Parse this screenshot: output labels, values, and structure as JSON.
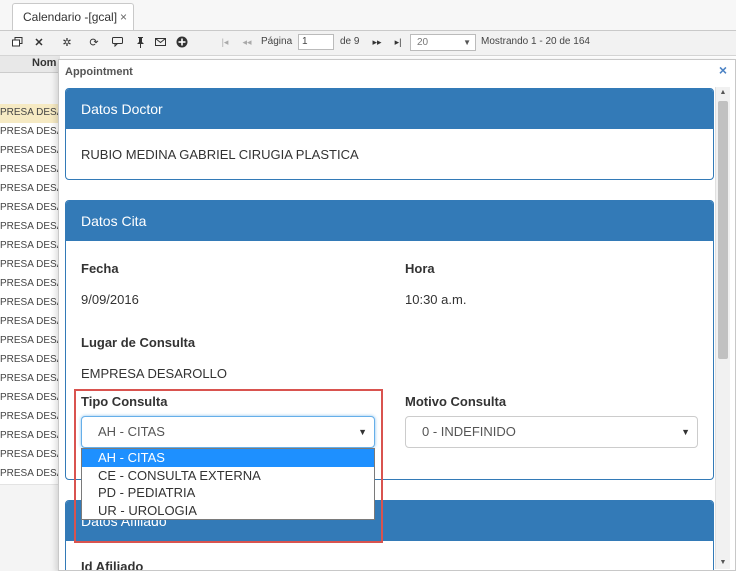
{
  "tab": {
    "title": "Calendario -[gcal]",
    "close": "×"
  },
  "toolbar": {
    "page_label": "Página",
    "page_value": "1",
    "of_label": "de 9",
    "page_size": "20",
    "range_text": "Mostrando 1 - 20 de 164"
  },
  "grid": {
    "column": "Nom",
    "rows": [
      "PRESA DESA",
      "PRESA DESA",
      "PRESA DESA",
      "PRESA DESA",
      "PRESA DESA",
      "PRESA DESA",
      "PRESA DESA",
      "PRESA DESA",
      "PRESA DESA",
      "PRESA DESA",
      "PRESA DESA",
      "PRESA DESA",
      "PRESA DESA",
      "PRESA DESA",
      "PRESA DESA",
      "PRESA DESA",
      "PRESA DESA",
      "PRESA DESA",
      "PRESA DESA",
      "PRESA DESA"
    ]
  },
  "dialog": {
    "title": "Appointment",
    "close": "×",
    "doctor": {
      "heading": "Datos Doctor",
      "name": "RUBIO MEDINA GABRIEL CIRUGIA PLASTICA"
    },
    "cita": {
      "heading": "Datos Cita",
      "fecha_label": "Fecha",
      "fecha_value": "9/09/2016",
      "hora_label": "Hora",
      "hora_value": "10:30 a.m.",
      "lugar_label": "Lugar de Consulta",
      "lugar_value": "EMPRESA DESAROLLO",
      "tipo_label": "Tipo Consulta",
      "tipo_selected": "AH - CITAS",
      "tipo_options": [
        "AH - CITAS",
        "CE - CONSULTA EXTERNA",
        "PD - PEDIATRIA",
        "UR - UROLOGIA"
      ],
      "motivo_label": "Motivo Consulta",
      "motivo_selected": "0 - INDEFINIDO"
    },
    "afiliado": {
      "heading": "Datos Afiliado",
      "id_label": "Id Afiliado"
    }
  },
  "colors": {
    "panel_blue": "#337ab7",
    "highlight_red": "#d9534f",
    "option_active": "#1e90ff"
  }
}
